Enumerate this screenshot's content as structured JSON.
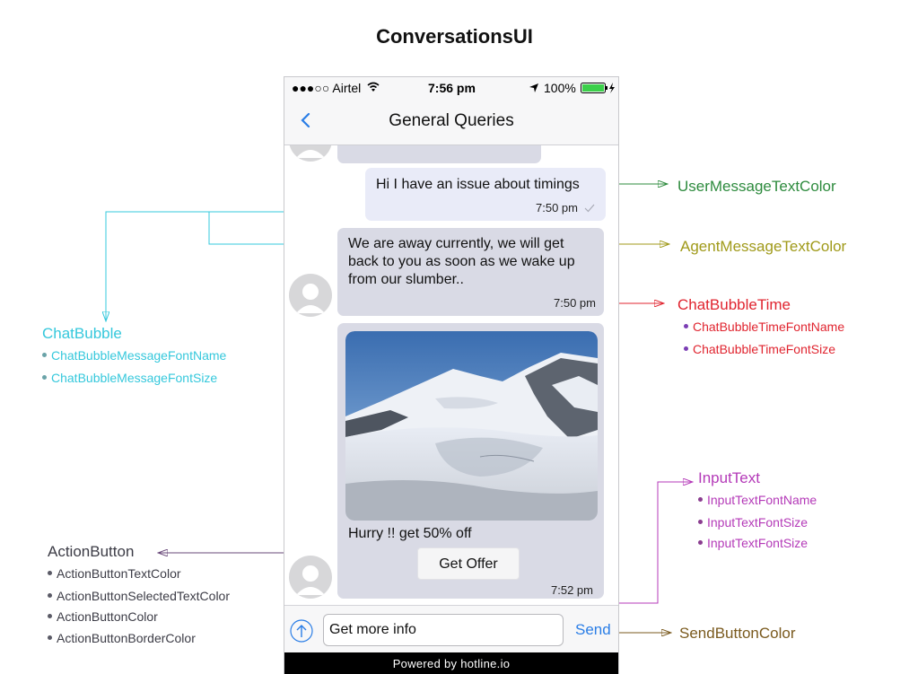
{
  "title": "ConversationsUI",
  "status_bar": {
    "carrier": "●●●○○ Airtel",
    "time": "7:56 pm",
    "battery": "100%"
  },
  "nav": {
    "title": "General Queries",
    "back_icon": "chevron-left-icon"
  },
  "messages": {
    "user_text": "Hi I have an issue about timings",
    "user_time": "7:50 pm",
    "agent_line1": "We are away currently, we will get",
    "agent_line2": "back to you as soon as we wake up",
    "agent_line3": "from our slumber..",
    "agent_time": "7:50 pm",
    "offer_text": "Hurry !! get 50% off",
    "offer_button": "Get Offer",
    "offer_time": "7:52 pm"
  },
  "input": {
    "value": "Get more info",
    "send_label": "Send",
    "upload_icon": "arrow-up-circle-icon"
  },
  "footer": "Powered by hotline.io",
  "annotations": {
    "user_message_text_color": "UserMessageTextColor",
    "agent_message_text_color": "AgentMessageTextColor",
    "chat_bubble_time": "ChatBubbleTime",
    "chat_bubble_time_items": [
      "ChatBubbleTimeFontName",
      "ChatBubbleTimeFontSize"
    ],
    "chat_bubble": "ChatBubble",
    "chat_bubble_items": [
      "ChatBubbleMessageFontName",
      "ChatBubbleMessageFontSize"
    ],
    "input_text": "InputText",
    "input_text_items": [
      "InputTextFontName",
      "InputTextFontSize",
      "InputTextFontSize"
    ],
    "action_button": "ActionButton",
    "action_button_items": [
      "ActionButtonTextColor",
      "ActionButtonSelectedTextColor",
      "ActionButtonColor",
      "ActionButtonBorderColor"
    ],
    "send_button_color": "SendButtonColor"
  },
  "colors": {
    "green": "#2e8b3e",
    "olive": "#a09a1a",
    "red": "#e0242f",
    "cyan": "#35c8dc",
    "magenta": "#b43ab8",
    "dark": "#3c3c46",
    "brown": "#7a5a1e",
    "link": "#2b7ee6"
  }
}
